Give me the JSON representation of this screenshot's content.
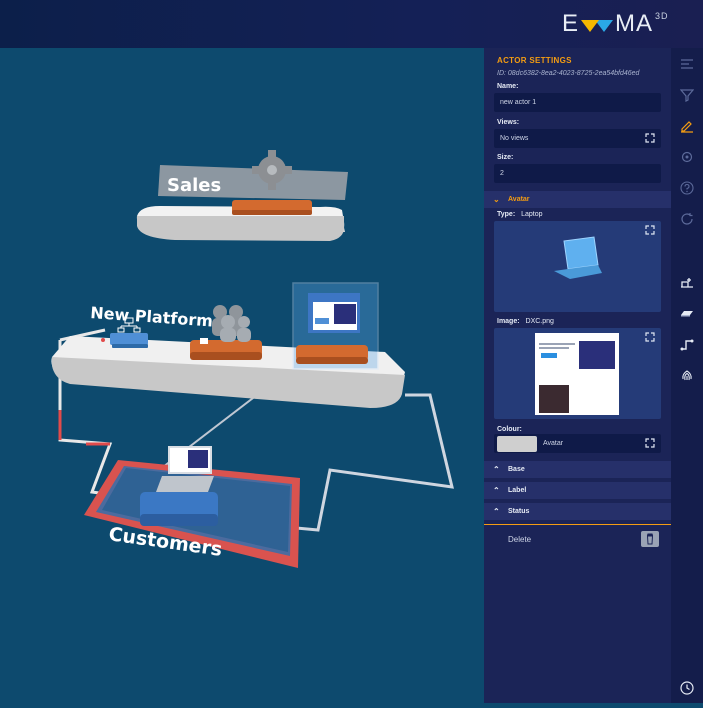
{
  "app": {
    "logo_text": "EVMA",
    "logo_superscript": "3D"
  },
  "scene": {
    "labels": {
      "sales": "Sales",
      "new_platform": "New Platform G",
      "customers": "Customers"
    }
  },
  "panel": {
    "title": "ACTOR SETTINGS",
    "id_text": "ID: 08dc6382-8ea2-4023-8725-2ea54bfd46ed",
    "name_label": "Name:",
    "name_value": "new actor 1",
    "views_label": "Views:",
    "views_value": "No views",
    "size_label": "Size:",
    "size_value": "2",
    "avatar_section": "Avatar",
    "type_label": "Type:",
    "type_value": "Laptop",
    "image_label": "Image:",
    "image_value": "DXC.png",
    "colour_label": "Colour:",
    "colour_value": "Avatar",
    "sections": [
      "Base",
      "Label",
      "Status"
    ],
    "delete_label": "Delete"
  },
  "rail": {
    "icons": [
      "menu-icon",
      "filter-icon",
      "edit-icon",
      "settings-icon",
      "help-icon",
      "refresh-icon",
      "add-actor-icon",
      "platform-icon",
      "path-icon",
      "fingerprint-icon",
      "history-icon"
    ]
  },
  "colors": {
    "accent": "#f39c12",
    "panel_bg": "#1b2457",
    "scene_bg": "#0d4a6e",
    "customers_border": "#d9534f"
  }
}
